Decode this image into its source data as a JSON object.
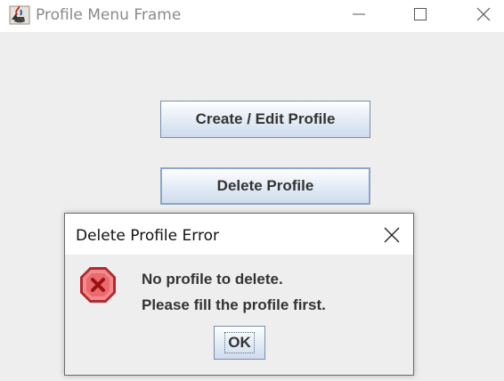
{
  "window": {
    "title": "Profile Menu Frame",
    "icon": "java-cup-icon",
    "controls": [
      "minimize-icon",
      "maximize-icon",
      "close-icon"
    ]
  },
  "main": {
    "create_button_label": "Create / Edit Profile",
    "delete_button_label": "Delete Profile"
  },
  "dialog": {
    "title": "Delete Profile Error",
    "icon": "error-icon",
    "message_line1": "No profile to delete.",
    "message_line2": "Please fill the profile first.",
    "ok_label": "OK"
  },
  "colors": {
    "background": "#eeeeee",
    "button_border": "#7a8ea6",
    "button_gradient_bottom": "#cfdced",
    "error_red": "#d9353a"
  }
}
